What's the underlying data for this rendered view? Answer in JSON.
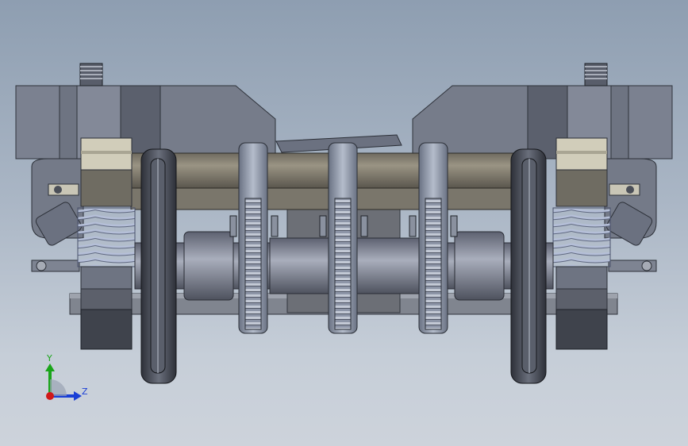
{
  "viewport": {
    "background_top": "#8e9eb1",
    "background_bottom": "#cdd3db"
  },
  "model": {
    "frame_color": "#6e7482",
    "axle_color": "#7f7a6e",
    "wheel_color": "#42464f",
    "gear_color": "#8c94a6",
    "spring_color": "#9aa6c2"
  },
  "triad": {
    "y_label": "Y",
    "z_label": "Z",
    "y_color": "#1aa51a",
    "z_color": "#1a3fd6",
    "x_color": "#d01818"
  }
}
